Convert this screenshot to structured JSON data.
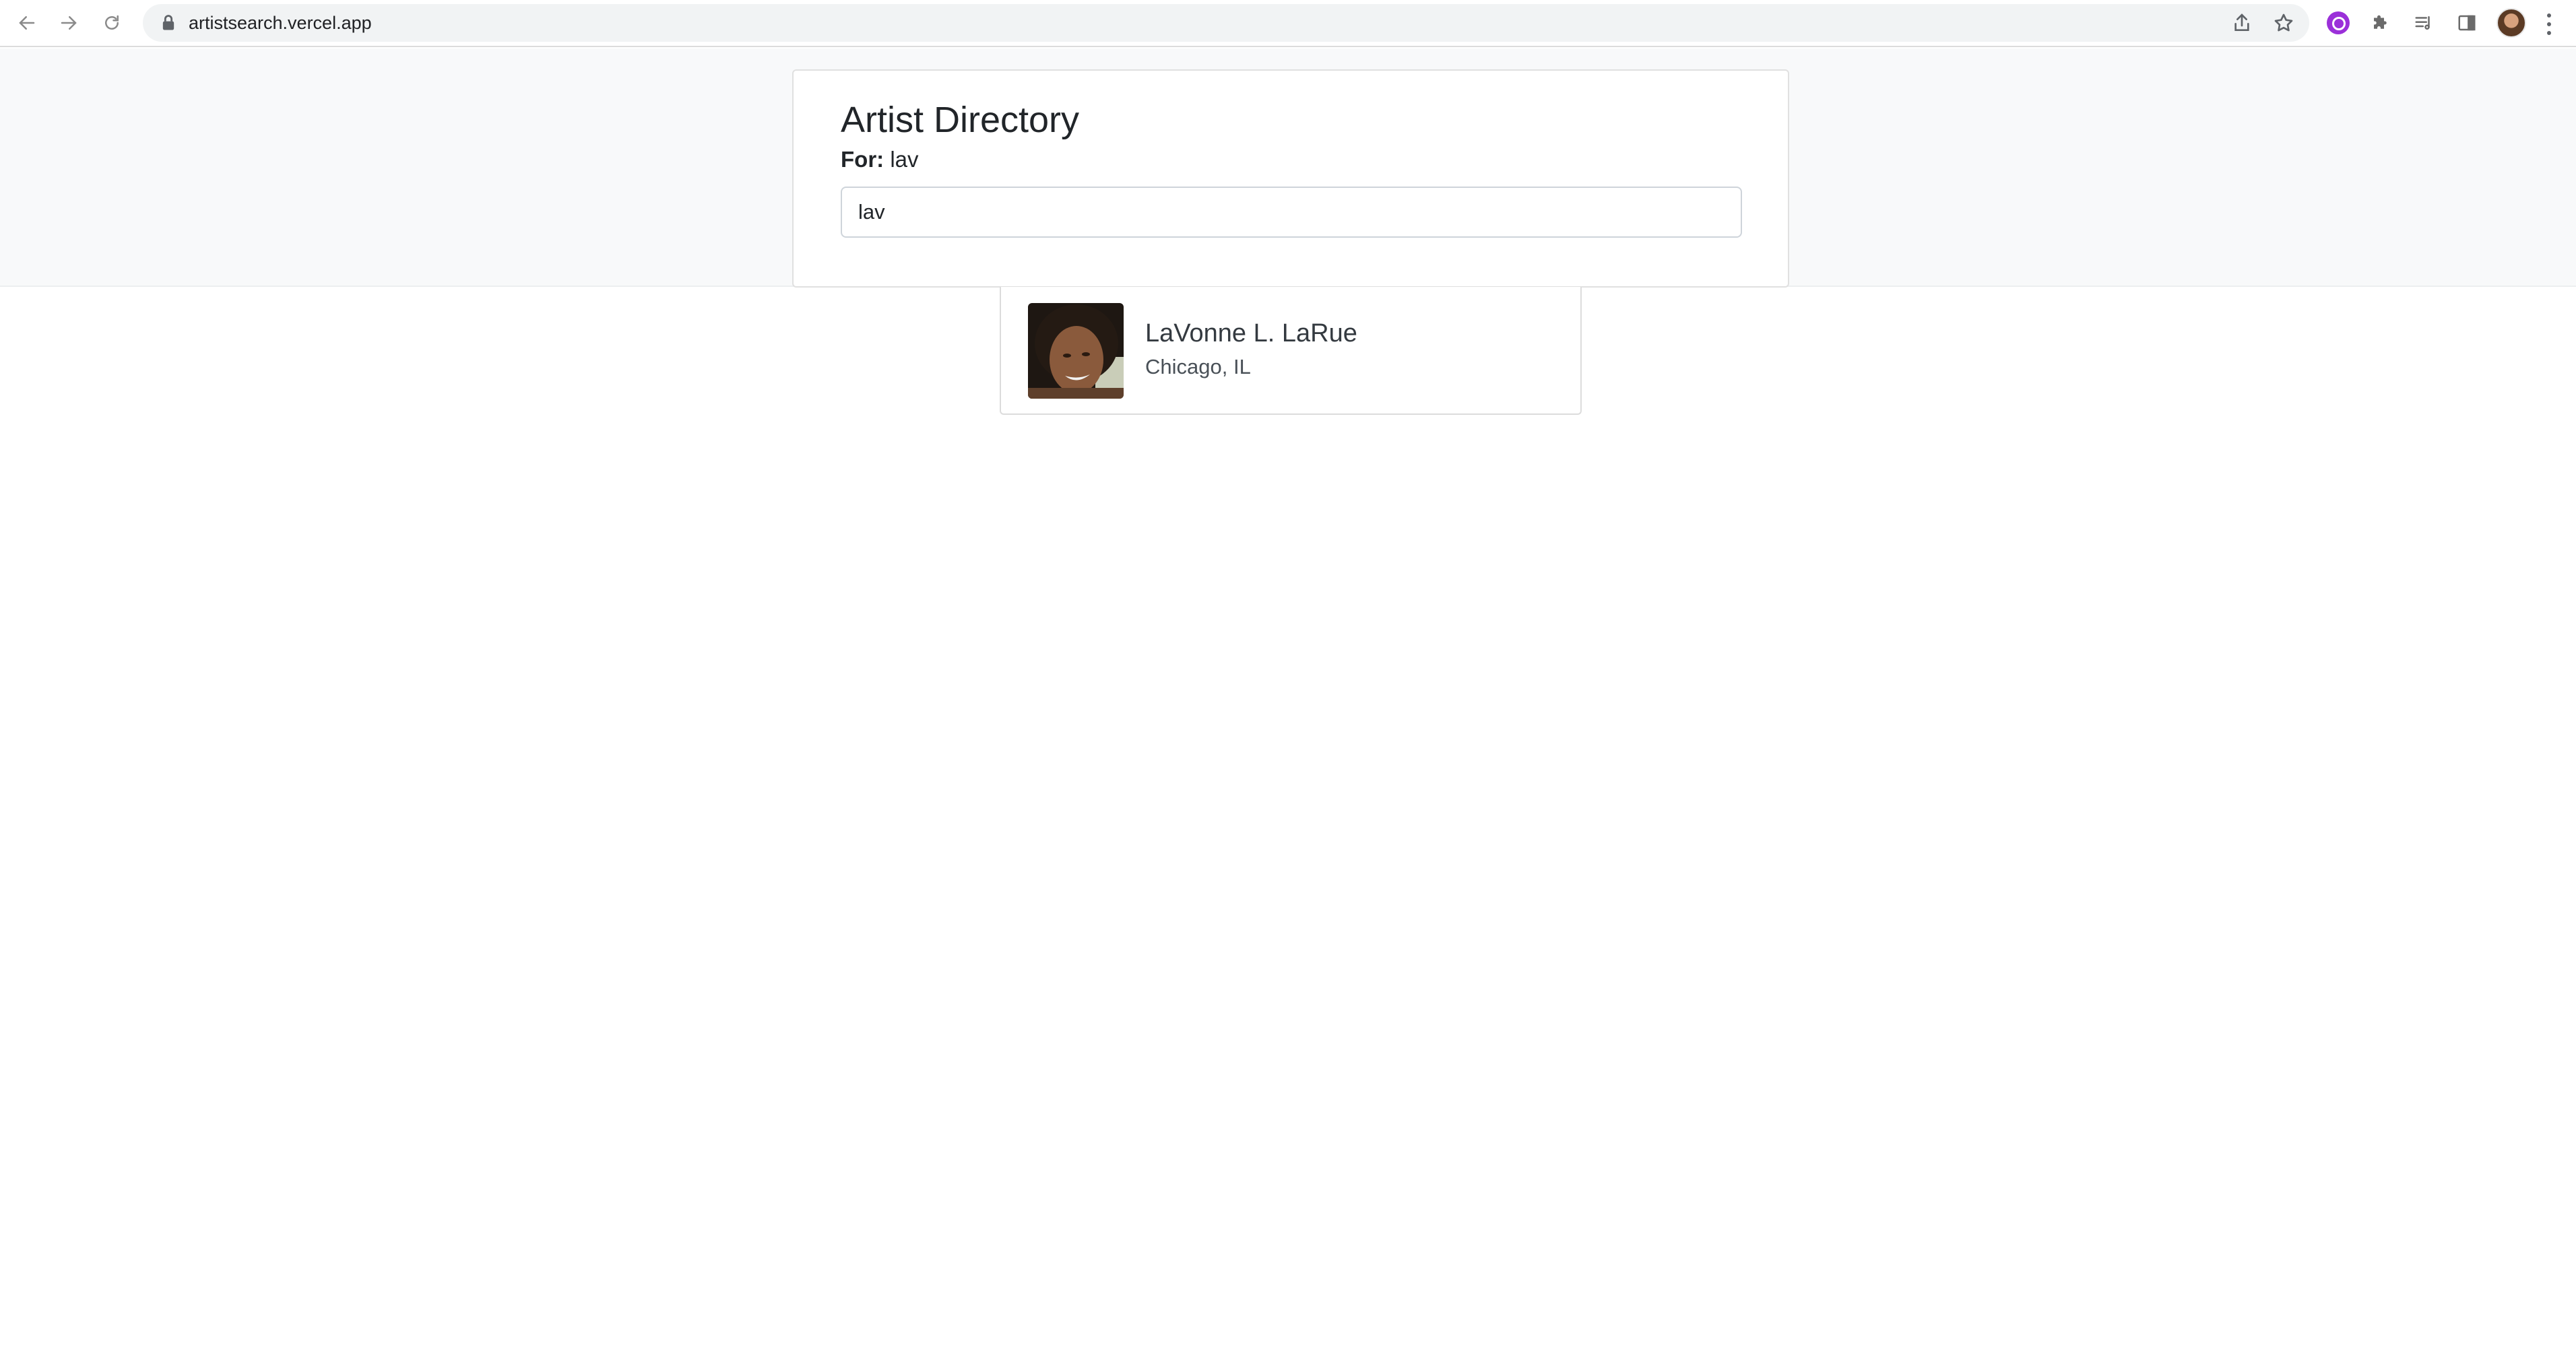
{
  "browser": {
    "url": "artistsearch.vercel.app",
    "icons": [
      "back-icon",
      "forward-icon",
      "reload-icon",
      "lock-icon",
      "share-icon",
      "star-icon",
      "extension-purple-icon",
      "puzzle-icon",
      "reading-list-icon",
      "side-panel-icon",
      "profile-avatar",
      "menu-icon"
    ]
  },
  "directory": {
    "title": "Artist Directory",
    "for_label": "For:",
    "for_value": "lav",
    "search_value": "lav"
  },
  "results": [
    {
      "name": "LaVonne L. LaRue",
      "location": "Chicago, IL"
    }
  ]
}
